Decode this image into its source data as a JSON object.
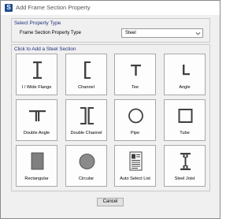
{
  "window": {
    "title": "Add Frame Section Property",
    "app_icon_glyph": "S"
  },
  "property_type": {
    "group_title": "Select Property Type",
    "field_label": "Frame Section Property Type",
    "selected_value": "Steel"
  },
  "section_group": {
    "title": "Click to Add a Steel Section"
  },
  "sections": [
    {
      "label": "I / Wide Flange",
      "icon": "i-wide-flange-icon"
    },
    {
      "label": "Channel",
      "icon": "channel-icon"
    },
    {
      "label": "Tee",
      "icon": "tee-icon"
    },
    {
      "label": "Angle",
      "icon": "angle-icon"
    },
    {
      "label": "Double Angle",
      "icon": "double-angle-icon"
    },
    {
      "label": "Double Channel",
      "icon": "double-channel-icon"
    },
    {
      "label": "Pipe",
      "icon": "pipe-icon"
    },
    {
      "label": "Tube",
      "icon": "tube-icon"
    },
    {
      "label": "Rectangular",
      "icon": "rectangular-icon"
    },
    {
      "label": "Circular",
      "icon": "circular-icon"
    },
    {
      "label": "Auto Select List",
      "icon": "auto-select-list-icon"
    },
    {
      "label": "Steel Joist",
      "icon": "steel-joist-icon"
    }
  ],
  "buttons": {
    "cancel_label": "Cancel"
  },
  "colors": {
    "group_title": "#1f2f7a",
    "app_icon": "#1d4f91",
    "section_fill": "#404040"
  }
}
